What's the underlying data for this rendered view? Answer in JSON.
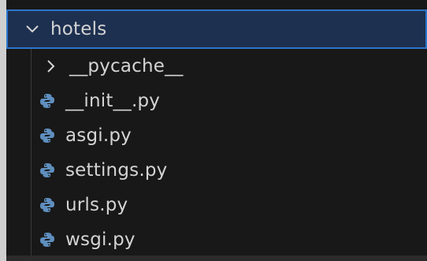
{
  "explorer": {
    "folder": {
      "label": "hotels",
      "icon": "chevron-down-icon",
      "expanded": true
    },
    "subfolder": {
      "label": "__pycache__",
      "icon": "chevron-right-icon",
      "expanded": false
    },
    "files": [
      {
        "label": "__init__.py",
        "icon": "python-icon"
      },
      {
        "label": "asgi.py",
        "icon": "python-icon"
      },
      {
        "label": "settings.py",
        "icon": "python-icon"
      },
      {
        "label": "urls.py",
        "icon": "python-icon"
      },
      {
        "label": "wsgi.py",
        "icon": "python-icon"
      }
    ]
  },
  "colors": {
    "background": "#181818",
    "selection_bg": "#1e3050",
    "selection_border": "#2d75cc",
    "text": "#d4d4d4",
    "python_icon": "#5f8fbf"
  }
}
